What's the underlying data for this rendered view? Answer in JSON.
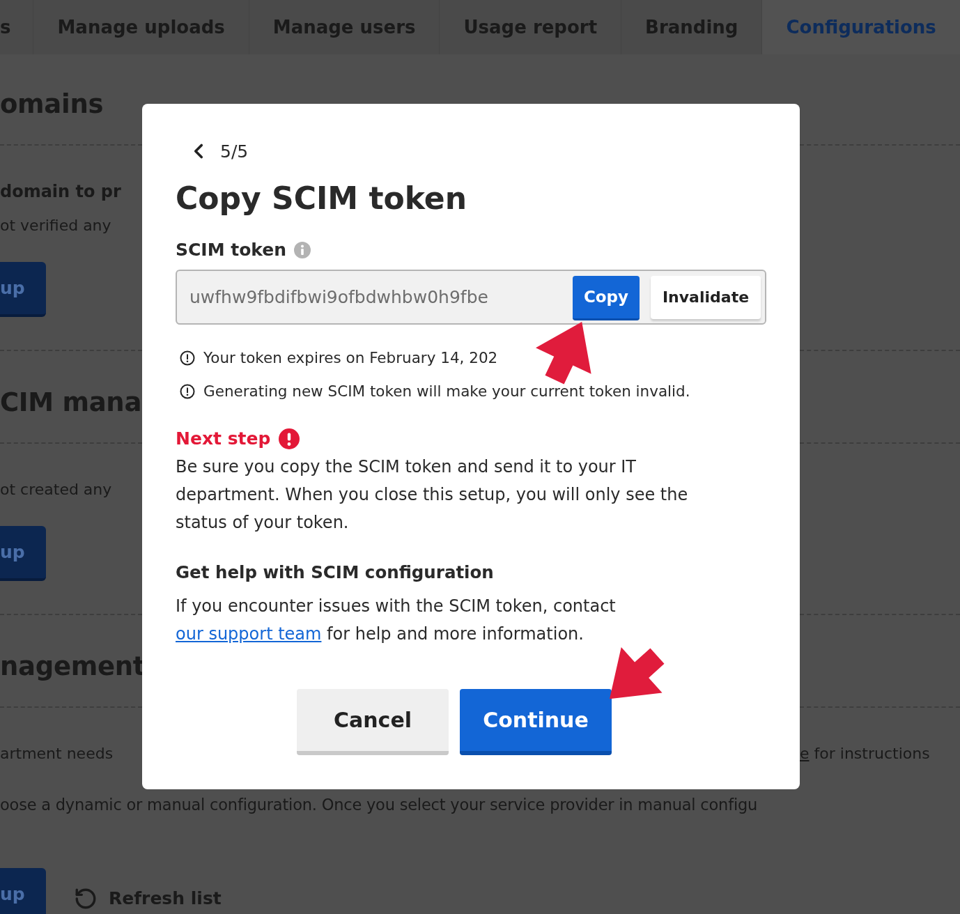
{
  "tabs": [
    {
      "label": "s",
      "selected": false
    },
    {
      "label": "Manage uploads",
      "selected": false
    },
    {
      "label": "Manage users",
      "selected": false
    },
    {
      "label": "Usage report",
      "selected": false
    },
    {
      "label": "Branding",
      "selected": false
    },
    {
      "label": "Configurations",
      "selected": true
    }
  ],
  "background": {
    "rows": [
      {
        "kind": "heading",
        "text": "omains"
      },
      {
        "kind": "divider"
      },
      {
        "kind": "bold",
        "text": "domain to pr"
      },
      {
        "kind": "text",
        "text": "ot verified any"
      },
      {
        "kind": "button",
        "label": "up"
      },
      {
        "kind": "divider"
      },
      {
        "kind": "heading",
        "text": "CIM mana"
      },
      {
        "kind": "divider"
      },
      {
        "kind": "text",
        "text": "ot created any"
      },
      {
        "kind": "button",
        "label": "up"
      },
      {
        "kind": "divider"
      },
      {
        "kind": "heading",
        "text": "nagement"
      },
      {
        "kind": "divider"
      },
      {
        "kind": "split",
        "text": "artment needs",
        "right_link": "e",
        "right_text": " for instructions"
      }
    ],
    "wide_text": "oose a dynamic or manual configuration. Once you select your service provider in manual configu",
    "footer": {
      "button": "up",
      "refresh": "Refresh list"
    }
  },
  "dialog": {
    "step": "5/5",
    "title": "Copy SCIM token",
    "field_label": "SCIM token",
    "token": "uwfhw9fbdifbwi9ofbdwhbw0h9fbe",
    "copy_button": "Copy",
    "invalidate_button": "Invalidate",
    "notes": [
      "Your token expires on February 14, 202",
      "Generating new SCIM token will make your current token invalid."
    ],
    "next_step_title": "Next step",
    "next_step_text": "Be sure you copy the SCIM token and send it to your IT department. When you close this setup, you will only see the status of your token.",
    "help_title": "Get help with SCIM configuration",
    "help_before": "If you encounter issues with the SCIM token, contact ",
    "help_link": "our support team",
    "help_after": " for help and more information.",
    "cancel_button": "Cancel",
    "continue_button": "Continue"
  }
}
